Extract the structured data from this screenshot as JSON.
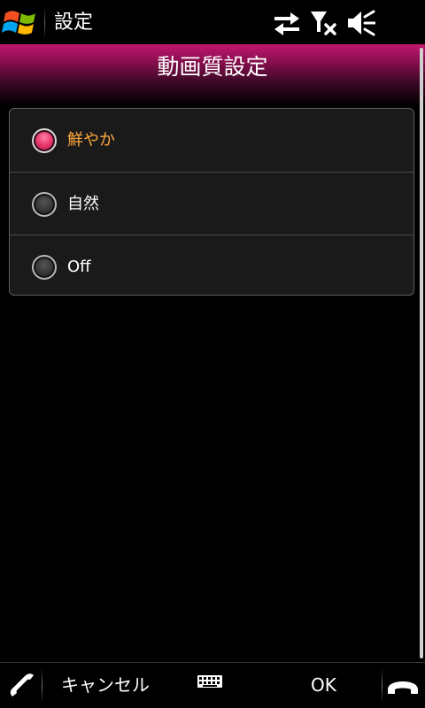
{
  "status_bar": {
    "app_title": "設定",
    "icons": [
      "windows-start-icon",
      "data-sync-icon",
      "no-signal-icon",
      "volume-muted-icon"
    ]
  },
  "header": {
    "title": "動画質設定",
    "accent_color": "#c3176e"
  },
  "options": {
    "items": [
      {
        "label": "鮮やか",
        "selected": true
      },
      {
        "label": "自然",
        "selected": false
      },
      {
        "label": "Off",
        "selected": false
      }
    ],
    "selected_color": "#ffa83c"
  },
  "softkeys": {
    "left_label": "キャンセル",
    "right_label": "OK",
    "icons": [
      "phone-call-icon",
      "keyboard-icon",
      "end-call-icon"
    ]
  }
}
